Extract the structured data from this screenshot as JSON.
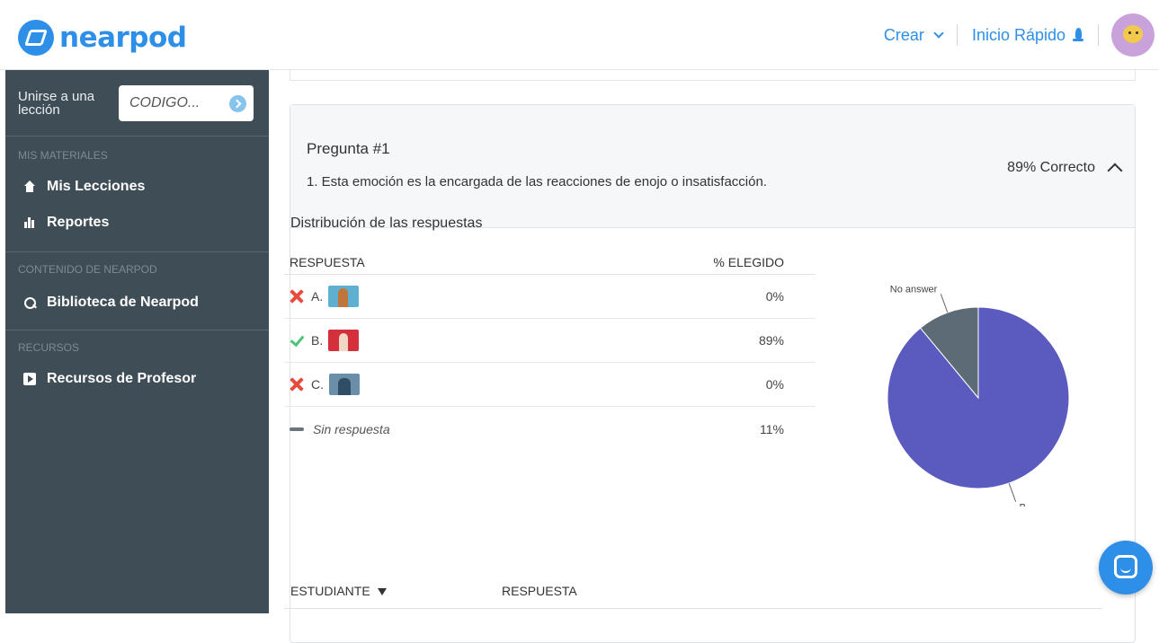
{
  "header": {
    "logo_text": "nearpod",
    "create_label": "Crear",
    "quick_start_label": "Inicio Rápido"
  },
  "sidebar": {
    "join_label": "Unirse a una lección",
    "join_placeholder": "CODIGO...",
    "sections": [
      {
        "title": "MIS MATERIALES",
        "items": [
          {
            "label": "Mis Lecciones",
            "icon": "home-icon"
          },
          {
            "label": "Reportes",
            "icon": "bar-chart-icon"
          }
        ]
      },
      {
        "title": "CONTENIDO DE NEARPOD",
        "items": [
          {
            "label": "Biblioteca de Nearpod",
            "icon": "search-icon"
          }
        ]
      },
      {
        "title": "RECURSOS",
        "items": [
          {
            "label": "Recursos de Profesor",
            "icon": "play-icon"
          }
        ]
      }
    ]
  },
  "question": {
    "title": "Pregunta #1",
    "text": "1. Esta emoción es la encargada de las reacciones de enojo o insatisfacción.",
    "score": "89% Correcto"
  },
  "distribution": {
    "title": "Distribución de las respuestas",
    "col_answer": "RESPUESTA",
    "col_pct": "% ELEGIDO",
    "rows": [
      {
        "letter": "A.",
        "pct": "0%",
        "status": "incorrect"
      },
      {
        "letter": "B.",
        "pct": "89%",
        "status": "correct"
      },
      {
        "letter": "C.",
        "pct": "0%",
        "status": "incorrect"
      },
      {
        "letter": "Sin respuesta",
        "pct": "11%",
        "status": "none"
      }
    ]
  },
  "chart_data": {
    "type": "pie",
    "slices": [
      {
        "label": "B",
        "value": 89,
        "color": "#5b5bbf"
      },
      {
        "label": "No answer",
        "value": 11,
        "color": "#5c6b75"
      }
    ]
  },
  "students": {
    "col_student": "ESTUDIANTE",
    "col_answer": "RESPUESTA"
  },
  "colors": {
    "brand": "#2d8fe8",
    "sidebar": "#3f4d57",
    "correct": "#4bc47a",
    "incorrect": "#e74c3c"
  }
}
